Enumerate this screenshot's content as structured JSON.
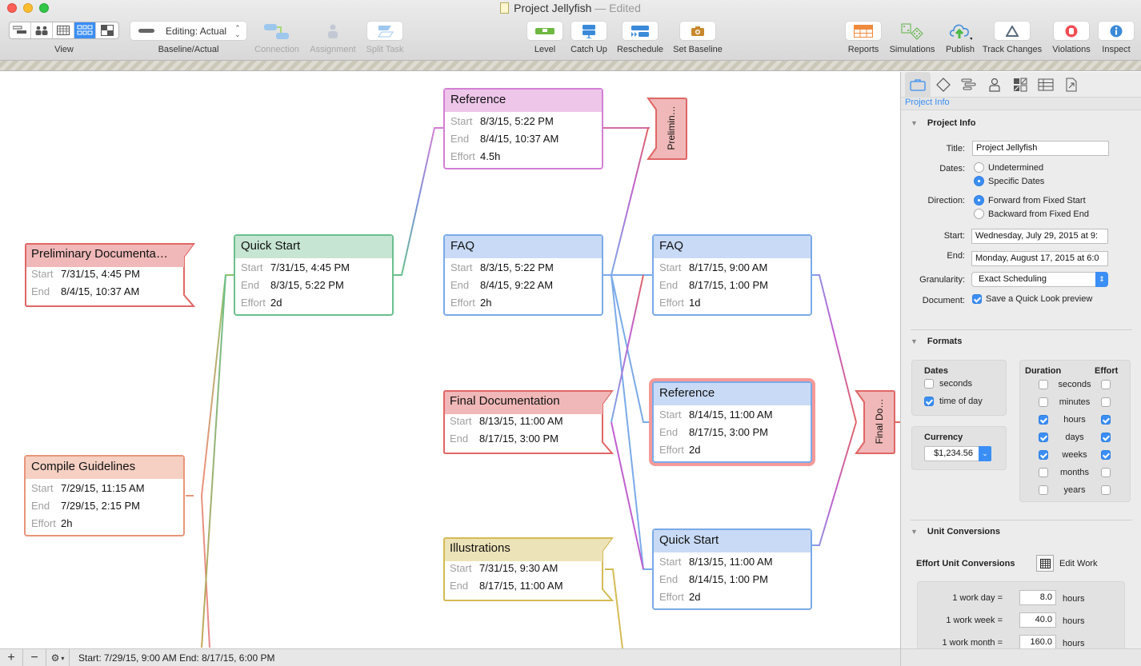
{
  "window": {
    "title": "Project Jellyfish",
    "separator": "—",
    "status": "Edited"
  },
  "toolbar": {
    "view_label": "View",
    "baseline_label": "Baseline/Actual",
    "baseline_value": "Editing: Actual",
    "connection_label": "Connection",
    "assignment_label": "Assignment",
    "split_task_label": "Split Task",
    "level_label": "Level",
    "catch_up_label": "Catch Up",
    "reschedule_label": "Reschedule",
    "set_baseline_label": "Set Baseline",
    "reports_label": "Reports",
    "simulations_label": "Simulations",
    "publish_label": "Publish",
    "track_changes_label": "Track Changes",
    "violations_label": "Violations",
    "inspect_label": "Inspect"
  },
  "network": {
    "labels": {
      "start": "Start",
      "end": "End",
      "effort": "Effort"
    },
    "nodes": [
      {
        "id": "prelim",
        "title": "Preliminary Documenta…",
        "start": "7/31/15, 4:45 PM",
        "end": "8/4/15, 10:37 AM",
        "kind": "group",
        "color": "#e06666",
        "head": "#f0b8b8"
      },
      {
        "id": "quickstart1",
        "title": "Quick Start",
        "start": "7/31/15, 4:45 PM",
        "end": "8/3/15, 5:22 PM",
        "effort": "2d",
        "kind": "task",
        "color": "#6abf8c",
        "head": "#c6e5d2"
      },
      {
        "id": "compile",
        "title": "Compile Guidelines",
        "start": "7/29/15, 11:15 AM",
        "end": "7/29/15, 2:15 PM",
        "effort": "2h",
        "kind": "task",
        "color": "#e8957a",
        "head": "#f5d0c3"
      },
      {
        "id": "reference1",
        "title": "Reference",
        "start": "8/3/15, 5:22 PM",
        "end": "8/4/15, 10:37 AM",
        "effort": "4.5h",
        "kind": "task",
        "color": "#d47fd4",
        "head": "#edc6ea"
      },
      {
        "id": "faq1",
        "title": "FAQ",
        "start": "8/3/15, 5:22 PM",
        "end": "8/4/15, 9:22 AM",
        "effort": "2h",
        "kind": "task",
        "color": "#7aaae8",
        "head": "#c8daf5"
      },
      {
        "id": "final",
        "title": "Final Documentation",
        "start": "8/13/15, 11:00 AM",
        "end": "8/17/15, 3:00 PM",
        "kind": "group",
        "color": "#e06666",
        "head": "#f0b8b8"
      },
      {
        "id": "illustrations",
        "title": "Illustrations",
        "start": "7/31/15, 9:30 AM",
        "end": "8/17/15, 11:00 AM",
        "kind": "group",
        "color": "#d4bb55",
        "head": "#ede3b8"
      },
      {
        "id": "faq2",
        "title": "FAQ",
        "start": "8/17/15, 9:00 AM",
        "end": "8/17/15, 1:00 PM",
        "effort": "1d",
        "kind": "task",
        "color": "#7aaae8",
        "head": "#c8daf5"
      },
      {
        "id": "reference2",
        "title": "Reference",
        "start": "8/14/15, 11:00 AM",
        "end": "8/17/15, 3:00 PM",
        "effort": "2d",
        "kind": "task",
        "color": "#7aaae8",
        "head": "#c8daf5",
        "selected": true
      },
      {
        "id": "quickstart2",
        "title": "Quick Start",
        "start": "8/13/15, 11:00 AM",
        "end": "8/14/15, 1:00 PM",
        "effort": "2d",
        "kind": "task",
        "color": "#7aaae8",
        "head": "#c8daf5"
      }
    ],
    "group_ends": [
      {
        "id": "prelim-end",
        "label": "Prelimin…"
      },
      {
        "id": "final-end",
        "label": "Final Do…"
      }
    ]
  },
  "statusbar": {
    "add": "+",
    "remove": "−",
    "text": "Start: 7/29/15, 9:00 AM End: 8/17/15, 6:00 PM"
  },
  "inspector": {
    "subtitle": "Project Info",
    "project_info": {
      "header": "Project Info",
      "title_label": "Title:",
      "title_value": "Project Jellyfish",
      "dates_label": "Dates:",
      "dates_options": [
        "Undetermined",
        "Specific Dates"
      ],
      "dates_selected": "Specific Dates",
      "direction_label": "Direction:",
      "direction_options": [
        "Forward from Fixed Start",
        "Backward from Fixed End"
      ],
      "direction_selected": "Forward from Fixed Start",
      "start_label": "Start:",
      "start_value": "Wednesday, July 29, 2015 at 9:",
      "end_label": "End:",
      "end_value": "Monday, August 17, 2015 at 6:0",
      "granularity_label": "Granularity:",
      "granularity_value": "Exact Scheduling",
      "document_label": "Document:",
      "document_option": "Save a Quick Look preview",
      "document_checked": true
    },
    "formats": {
      "header": "Formats",
      "dates_title": "Dates",
      "dates_items": [
        {
          "label": "seconds",
          "checked": false
        },
        {
          "label": "time of day",
          "checked": true
        }
      ],
      "currency_title": "Currency",
      "currency_value": "$1,234.56",
      "duration_title": "Duration",
      "effort_title": "Effort",
      "units": [
        {
          "label": "seconds",
          "duration": false,
          "effort": false
        },
        {
          "label": "minutes",
          "duration": false,
          "effort": false
        },
        {
          "label": "hours",
          "duration": true,
          "effort": true
        },
        {
          "label": "days",
          "duration": true,
          "effort": true
        },
        {
          "label": "weeks",
          "duration": true,
          "effort": true
        },
        {
          "label": "months",
          "duration": false,
          "effort": false
        },
        {
          "label": "years",
          "duration": false,
          "effort": false
        }
      ]
    },
    "unit_conversions": {
      "header": "Unit Conversions",
      "effort_title": "Effort Unit Conversions",
      "edit_work": "Edit Work",
      "rows": [
        {
          "label": "1 work day =",
          "value": "8.0",
          "unit": "hours"
        },
        {
          "label": "1 work week =",
          "value": "40.0",
          "unit": "hours"
        },
        {
          "label": "1 work month =",
          "value": "160.0",
          "unit": "hours"
        }
      ]
    }
  }
}
